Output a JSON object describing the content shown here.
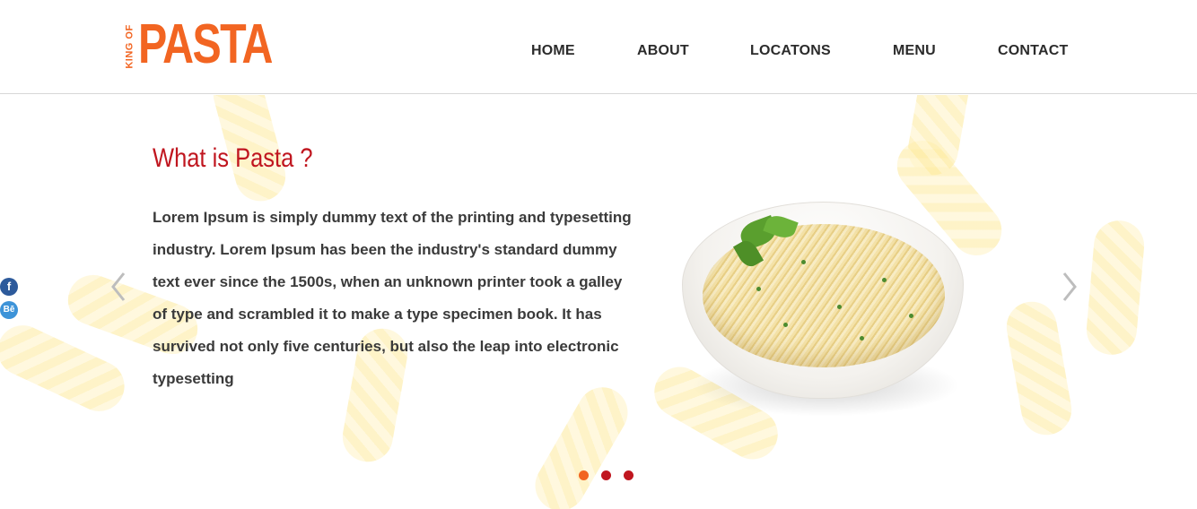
{
  "logo": {
    "small_text": "KING OF",
    "big_text": "PASTA",
    "color": "#f26522"
  },
  "nav": {
    "items": [
      {
        "label": "HOME"
      },
      {
        "label": "ABOUT"
      },
      {
        "label": "LOCATONS"
      },
      {
        "label": "MENU"
      },
      {
        "label": "CONTACT"
      }
    ]
  },
  "hero": {
    "title": "What is Pasta ?",
    "title_color": "#c0161f",
    "description": "Lorem Ipsum is simply dummy text of the printing and typesetting industry. Lorem Ipsum has been the industry's standard dummy text ever since the 1500s, when an unknown printer took a galley of type and scrambled it to make a type specimen book. It has survived not only five centuries, but also the leap into electronic typesetting",
    "image": "pasta-bowl",
    "prev_icon": "chevron-left-icon",
    "next_icon": "chevron-right-icon"
  },
  "social": {
    "facebook_label": "f",
    "behance_label": "Bē"
  },
  "carousel": {
    "active_index": 0,
    "dot_count": 3,
    "active_color": "#f26522",
    "inactive_color": "#c0161f"
  }
}
